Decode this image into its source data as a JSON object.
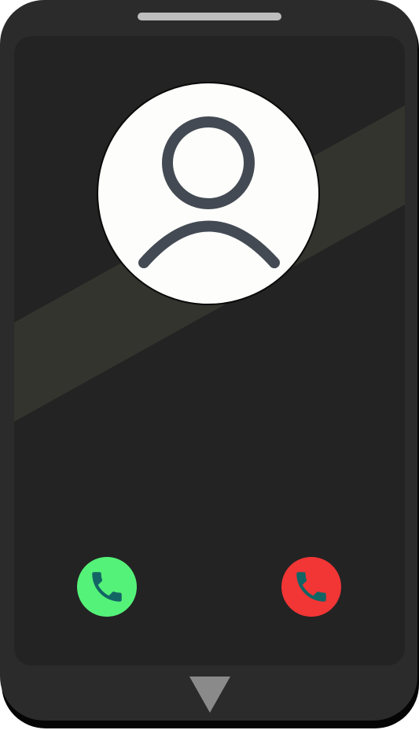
{
  "colors": {
    "body": "#2b2b2b",
    "body_shadow": "#050505",
    "screen": "#232323",
    "glare": "#34342f",
    "avatar_bg": "#fdfdfb",
    "avatar_icon": "#444a53",
    "accept": "#55f279",
    "decline": "#f23535",
    "handset": "#136565",
    "speaker": "#bdbdbd",
    "nav_arrow": "#8a8a8a"
  },
  "icons": {
    "avatar": "user-icon",
    "accept": "phone-handset-icon",
    "decline": "phone-handset-icon",
    "nav": "triangle-down-icon"
  }
}
